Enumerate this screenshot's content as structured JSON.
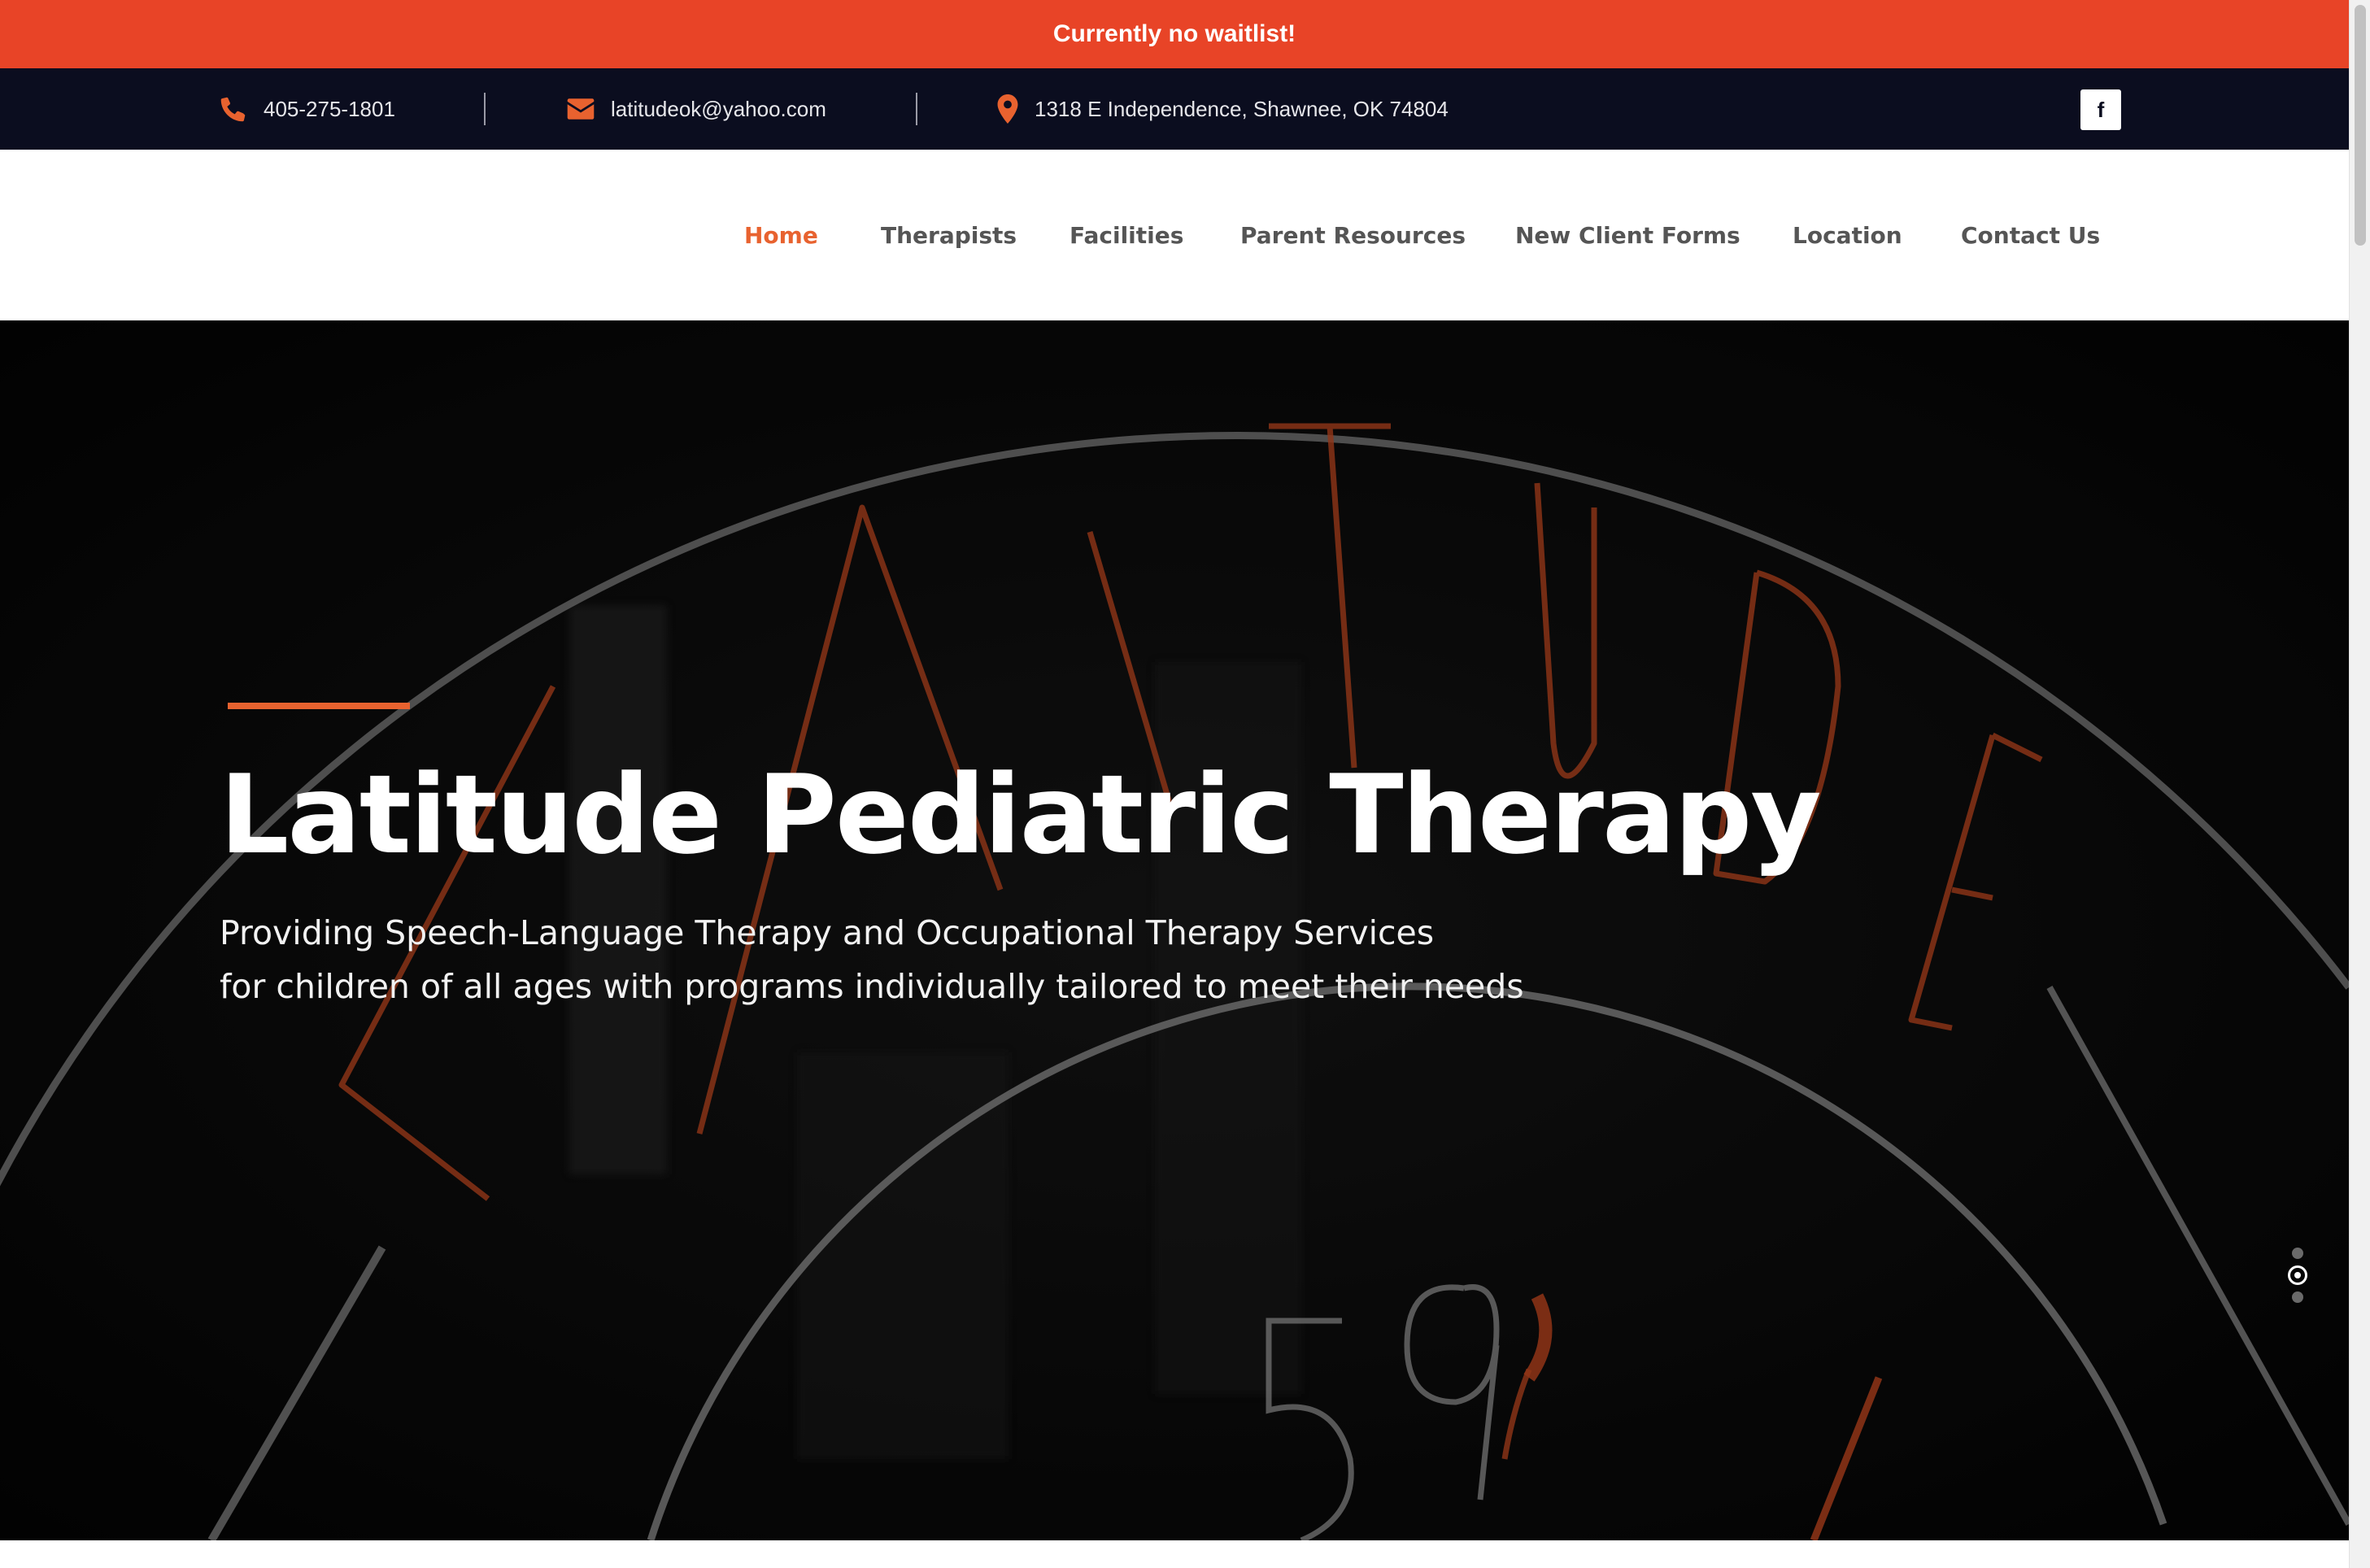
{
  "announcement": {
    "text": "Currently no waitlist!"
  },
  "contact_bar": {
    "phone": "405-275-1801",
    "email": "latitudeok@yahoo.com",
    "address": "1318 E Independence, Shawnee, OK 74804",
    "social_icon": "f"
  },
  "nav": {
    "items": [
      {
        "label": "Home",
        "active": true
      },
      {
        "label": "Therapists"
      },
      {
        "label": "Facilities"
      },
      {
        "label": "Parent Resources"
      },
      {
        "label": "New Client Forms"
      },
      {
        "label": "Location"
      },
      {
        "label": "Contact Us"
      }
    ]
  },
  "hero": {
    "title": "Latitude Pediatric Therapy",
    "subtitle_line1": "Providing Speech-Language Therapy and Occupational Therapy Services",
    "subtitle_line2": "for children of all ages with programs individually tailored to meet their needs",
    "slides_count": 3,
    "active_slide": 2
  },
  "colors": {
    "accent": "#e8622f",
    "announcement_bg": "#e84427",
    "topbar_bg": "#0b0d1f",
    "nav_text": "#555555",
    "hero_bg": "#050505"
  }
}
